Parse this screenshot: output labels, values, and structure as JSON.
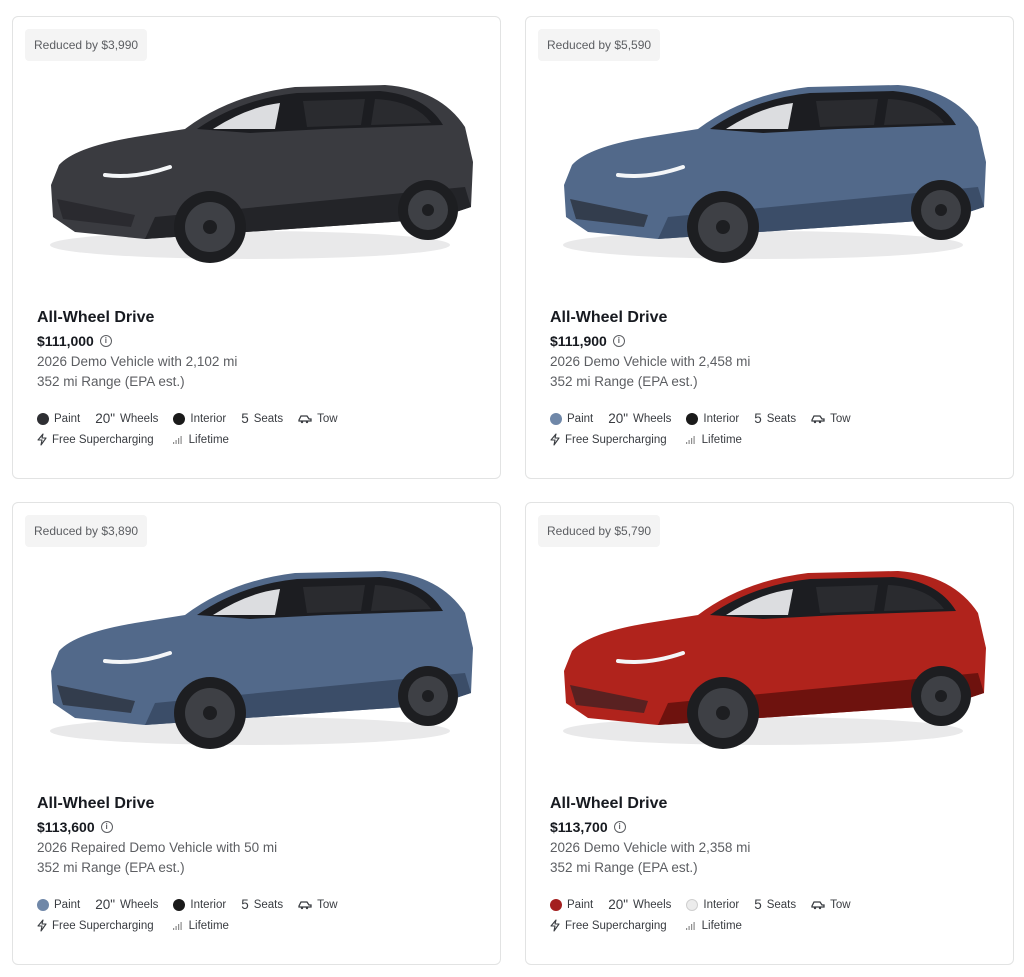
{
  "cards": [
    {
      "badge": "Reduced by $3,990",
      "title": "All-Wheel Drive",
      "price": "$111,000",
      "description": "2026 Demo Vehicle with 2,102 mi",
      "range": "352 mi Range (EPA est.)",
      "paint_label": "Paint",
      "paint_color": "#2e2f33",
      "wheels_size": "20\"",
      "wheels_label": "Wheels",
      "interior_label": "Interior",
      "interior_color": "#1a1a1a",
      "seats_count": "5",
      "seats_label": "Seats",
      "tow_label": "Tow",
      "supercharging_label": "Free Supercharging",
      "lifetime_label": "Lifetime",
      "car_body": "#3a3b40",
      "car_shade": "#232428"
    },
    {
      "badge": "Reduced by $5,590",
      "title": "All-Wheel Drive",
      "price": "$111,900",
      "description": "2026 Demo Vehicle with 2,458 mi",
      "range": "352 mi Range (EPA est.)",
      "paint_label": "Paint",
      "paint_color": "#6f87a8",
      "wheels_size": "20\"",
      "wheels_label": "Wheels",
      "interior_label": "Interior",
      "interior_color": "#1a1a1a",
      "seats_count": "5",
      "seats_label": "Seats",
      "tow_label": "Tow",
      "supercharging_label": "Free Supercharging",
      "lifetime_label": "Lifetime",
      "car_body": "#52698a",
      "car_shade": "#3b4d68"
    },
    {
      "badge": "Reduced by $3,890",
      "title": "All-Wheel Drive",
      "price": "$113,600",
      "description": "2026 Repaired Demo Vehicle with 50 mi",
      "range": "352 mi Range (EPA est.)",
      "paint_label": "Paint",
      "paint_color": "#6f87a8",
      "wheels_size": "20\"",
      "wheels_label": "Wheels",
      "interior_label": "Interior",
      "interior_color": "#1a1a1a",
      "seats_count": "5",
      "seats_label": "Seats",
      "tow_label": "Tow",
      "supercharging_label": "Free Supercharging",
      "lifetime_label": "Lifetime",
      "car_body": "#52698a",
      "car_shade": "#3b4d68"
    },
    {
      "badge": "Reduced by $5,790",
      "title": "All-Wheel Drive",
      "price": "$113,700",
      "description": "2026 Demo Vehicle with 2,358 mi",
      "range": "352 mi Range (EPA est.)",
      "paint_label": "Paint",
      "paint_color": "#a31f1f",
      "wheels_size": "20\"",
      "wheels_label": "Wheels",
      "interior_label": "Interior",
      "interior_color": "#ececec",
      "seats_count": "5",
      "seats_label": "Seats",
      "tow_label": "Tow",
      "supercharging_label": "Free Supercharging",
      "lifetime_label": "Lifetime",
      "car_body": "#b0231c",
      "car_shade": "#6e120e"
    }
  ]
}
